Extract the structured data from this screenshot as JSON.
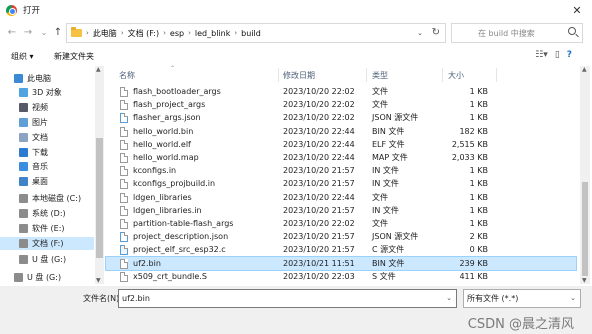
{
  "window": {
    "title": "打开",
    "close_glyph": "✕"
  },
  "nav": {
    "back": "←",
    "forward": "→",
    "down": "⌄",
    "up": "↑"
  },
  "breadcrumbs": [
    "此电脑",
    "文档 (F:)",
    "esp",
    "led_blink",
    "build"
  ],
  "search": {
    "placeholder": "在 build 中搜索"
  },
  "toolbar": {
    "organize_label": "组织 ▾",
    "new_folder_label": "新建文件夹"
  },
  "sidebar": {
    "items": [
      {
        "label": "此电脑",
        "icon": "computer-icon",
        "color": "#3c8ad6"
      },
      {
        "label": "3D 对象",
        "icon": "cube-icon",
        "color": "#4fa3e0"
      },
      {
        "label": "视频",
        "icon": "video-icon",
        "color": "#555a66"
      },
      {
        "label": "图片",
        "icon": "picture-icon",
        "color": "#5e9fd6"
      },
      {
        "label": "文档",
        "icon": "document-icon",
        "color": "#8aa4c2"
      },
      {
        "label": "下载",
        "icon": "download-icon",
        "color": "#2b7bd0"
      },
      {
        "label": "音乐",
        "icon": "music-icon",
        "color": "#3a8ee0"
      },
      {
        "label": "桌面",
        "icon": "desktop-icon",
        "color": "#3f83c9"
      },
      {
        "label": "本地磁盘 (C:)",
        "icon": "drive-icon",
        "color": "#8c8c8c"
      },
      {
        "label": "系统 (D:)",
        "icon": "drive-icon",
        "color": "#8c8c8c"
      },
      {
        "label": "软件 (E:)",
        "icon": "drive-icon",
        "color": "#8c8c8c"
      },
      {
        "label": "文档 (F:)",
        "icon": "drive-icon",
        "color": "#8c8c8c"
      },
      {
        "label": "U 盘 (G:)",
        "icon": "usb-drive-icon",
        "color": "#8c8c8c"
      },
      {
        "label": "U 盘 (G:)",
        "icon": "usb-drive-icon",
        "color": "#8c8c8c"
      }
    ],
    "selected_index": 11
  },
  "columns": {
    "name": "名称",
    "modified": "修改日期",
    "type": "类型",
    "size": "大小"
  },
  "files": [
    {
      "name": "flash_bootloader_args",
      "modified": "2023/10/20 22:02",
      "type": "文件",
      "size": "1 KB",
      "icon": "file-icon"
    },
    {
      "name": "flash_project_args",
      "modified": "2023/10/20 22:02",
      "type": "文件",
      "size": "1 KB",
      "icon": "file-icon"
    },
    {
      "name": "flasher_args.json",
      "modified": "2023/10/20 22:02",
      "type": "JSON 源文件",
      "size": "1 KB",
      "icon": "json-file-icon"
    },
    {
      "name": "hello_world.bin",
      "modified": "2023/10/20 22:44",
      "type": "BIN 文件",
      "size": "182 KB",
      "icon": "file-icon"
    },
    {
      "name": "hello_world.elf",
      "modified": "2023/10/20 22:44",
      "type": "ELF 文件",
      "size": "2,515 KB",
      "icon": "file-icon"
    },
    {
      "name": "hello_world.map",
      "modified": "2023/10/20 22:44",
      "type": "MAP 文件",
      "size": "2,033 KB",
      "icon": "file-icon"
    },
    {
      "name": "kconfigs.in",
      "modified": "2023/10/20 21:57",
      "type": "IN 文件",
      "size": "1 KB",
      "icon": "file-icon"
    },
    {
      "name": "kconfigs_projbuild.in",
      "modified": "2023/10/20 21:57",
      "type": "IN 文件",
      "size": "1 KB",
      "icon": "file-icon"
    },
    {
      "name": "ldgen_libraries",
      "modified": "2023/10/20 22:44",
      "type": "文件",
      "size": "1 KB",
      "icon": "file-icon"
    },
    {
      "name": "ldgen_libraries.in",
      "modified": "2023/10/20 21:57",
      "type": "IN 文件",
      "size": "1 KB",
      "icon": "file-icon"
    },
    {
      "name": "partition-table-flash_args",
      "modified": "2023/10/20 22:02",
      "type": "文件",
      "size": "1 KB",
      "icon": "file-icon"
    },
    {
      "name": "project_description.json",
      "modified": "2023/10/20 21:57",
      "type": "JSON 源文件",
      "size": "2 KB",
      "icon": "json-file-icon"
    },
    {
      "name": "project_elf_src_esp32.c",
      "modified": "2023/10/20 21:57",
      "type": "C 源文件",
      "size": "0 KB",
      "icon": "c-file-icon"
    },
    {
      "name": "uf2.bin",
      "modified": "2023/10/21 11:51",
      "type": "BIN 文件",
      "size": "239 KB",
      "icon": "file-icon"
    },
    {
      "name": "x509_crt_bundle.S",
      "modified": "2023/10/20 22:03",
      "type": "S 文件",
      "size": "411 KB",
      "icon": "file-icon"
    }
  ],
  "selected_file_index": 13,
  "footer": {
    "filename_label": "文件名(N):",
    "filename_value": "uf2.bin",
    "filetype_value": "所有文件 (*.*)"
  },
  "watermark": "CSDN @晨之清风",
  "colors": {
    "selection": "#cce8ff",
    "header_text": "#4c607a",
    "folder": "#f5c242"
  }
}
